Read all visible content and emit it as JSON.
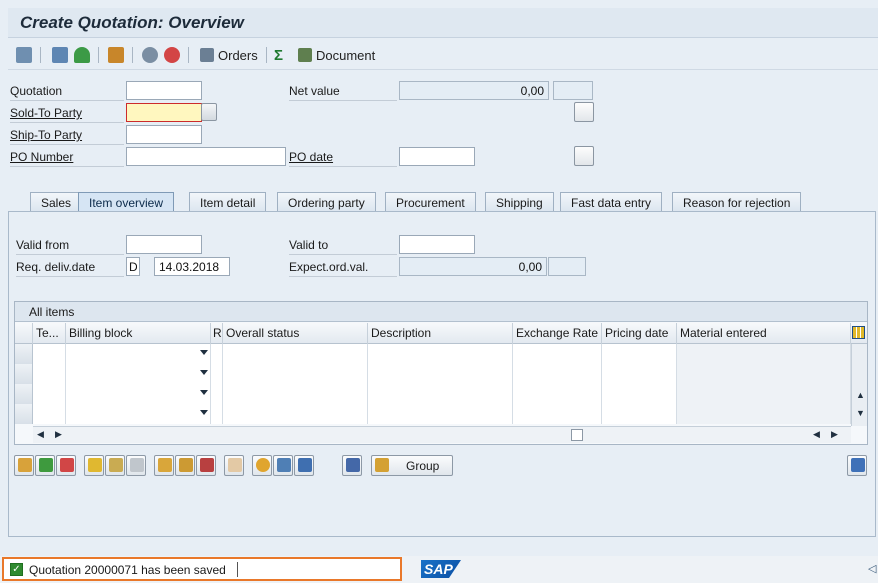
{
  "window": {
    "title": "Create Quotation: Overview"
  },
  "toolbar": {
    "orders_label": "Orders",
    "document_label": "Document"
  },
  "header": {
    "quotation_label": "Quotation",
    "quotation_value": "",
    "net_value_label": "Net value",
    "net_value_value": "0,00",
    "sold_to_label": "Sold-To Party",
    "sold_to_value": "",
    "ship_to_label": "Ship-To Party",
    "ship_to_value": "",
    "po_number_label": "PO Number",
    "po_number_value": "",
    "po_date_label": "PO date",
    "po_date_value": ""
  },
  "tabs": [
    "Sales",
    "Item overview",
    "Item detail",
    "Ordering party",
    "Procurement",
    "Shipping",
    "Fast data entry",
    "Reason for rejection"
  ],
  "active_tab": "Item overview",
  "item_overview": {
    "valid_from_label": "Valid from",
    "valid_from_value": "",
    "valid_to_label": "Valid to",
    "valid_to_value": "",
    "req_deliv_label": "Req. deliv.date",
    "req_deliv_format": "D",
    "req_deliv_value": "14.03.2018",
    "expect_ord_label": "Expect.ord.val.",
    "expect_ord_value": "0,00"
  },
  "grid": {
    "title": "All items",
    "columns": [
      "Te...",
      "Billing block",
      "R",
      "Overall status",
      "Description",
      "Exchange Rate",
      "Pricing date",
      "Material entered"
    ]
  },
  "buttons": {
    "group_label": "Group"
  },
  "status": {
    "message": "Quotation 20000071 has been saved"
  },
  "branding": {
    "logo": "SAP"
  },
  "colors": {
    "required_field_bg": "#fff7bf",
    "required_field_border": "#cc2b2b",
    "status_highlight": "#e9782a",
    "success_check": "#2f8a2f"
  }
}
